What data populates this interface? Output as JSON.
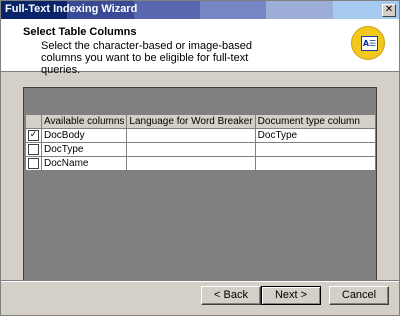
{
  "window": {
    "title": "Full-Text Indexing Wizard",
    "close_glyph": "✕"
  },
  "header": {
    "title": "Select Table Columns",
    "description": "Select the character-based or image-based columns you want to be eligible for full-text queries.",
    "icon_glyph": "A☰"
  },
  "grid": {
    "columns": [
      "",
      "Available columns",
      "Language for Word Breaker",
      "Document type column"
    ],
    "rows": [
      {
        "checked": true,
        "column": "DocBody",
        "language": "",
        "doctype": "DocType"
      },
      {
        "checked": false,
        "column": "DocType",
        "language": "",
        "doctype": ""
      },
      {
        "checked": false,
        "column": "DocName",
        "language": "",
        "doctype": ""
      }
    ],
    "check_glyph": "✓"
  },
  "buttons": {
    "back": "< Back",
    "next": "Next >",
    "cancel": "Cancel"
  },
  "colors": {
    "title_gradient": [
      "#0a246a",
      "#3a4f9e",
      "#5d72b8",
      "#8597cf",
      "#a6caf0"
    ],
    "dialog_bg": "#d4d0c8",
    "grid_bg": "#808080",
    "icon_bg": "#f2c81e"
  }
}
